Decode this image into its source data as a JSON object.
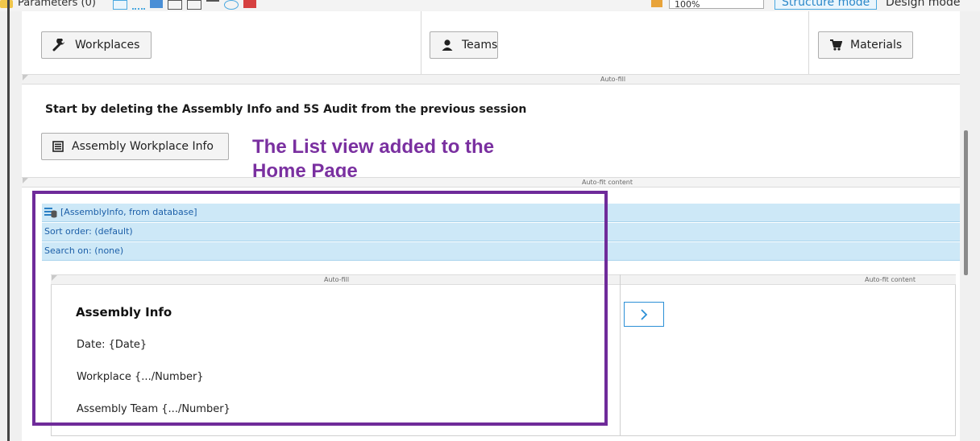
{
  "toolbar": {
    "params_label": "Parameters (0)",
    "zoom_value": "100%",
    "structure_mode": "Structure mode",
    "design_mode": "Design mode"
  },
  "top_buttons": {
    "workplaces": "Workplaces",
    "teams": "Teams",
    "materials": "Materials"
  },
  "bands": {
    "auto_fill_1": "Auto-fill",
    "auto_fit_1": "Auto-fit content",
    "auto_fill_2": "Auto-fill",
    "auto_fit_2": "Auto-fit content"
  },
  "section": {
    "heading": "Start by deleting the Assembly Info and 5S Audit from the previous session",
    "assembly_button": "Assembly Workplace Info"
  },
  "callout": {
    "line1": "The List view added to the",
    "line2": "Home Page"
  },
  "listview": {
    "source": "[AssemblyInfo, from database]",
    "sort_order": "Sort order: (default)",
    "search_on": "Search on: (none)"
  },
  "card": {
    "title": "Assembly Info",
    "date": "Date: {Date}",
    "workplace": "Workplace {.../Number}",
    "team": "Assembly Team {.../Number}"
  },
  "colors": {
    "accent_purple": "#6f2b9a",
    "listview_blue": "#cde8f7",
    "link_blue": "#1c5fa8",
    "arrow_blue": "#2b8fd6"
  },
  "icons": [
    "wrench-icon",
    "user-icon",
    "cart-icon",
    "list-form-icon",
    "database-list-icon",
    "chevron-right-icon"
  ]
}
